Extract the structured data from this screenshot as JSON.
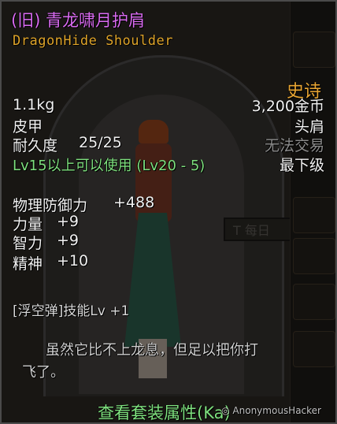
{
  "item": {
    "name": "(旧) 青龙啸月护肩",
    "name_en": "DragonHide Shoulder",
    "rarity": "史诗",
    "weight": "1.1kg",
    "price": "3,200金币",
    "material": "皮甲",
    "slot": "头肩",
    "durability_label": "耐久度",
    "durability_value": "25/25",
    "trade": "无法交易",
    "level_req": "Lv15以上可以使用 (Lv20 - 5)",
    "grade": "最下级",
    "stats": [
      {
        "label": "物理防御力",
        "value": "+488"
      },
      {
        "label": "力量",
        "value": "+9"
      },
      {
        "label": "智力",
        "value": "+9"
      },
      {
        "label": "精神",
        "value": "+10"
      }
    ],
    "skill": "[浮空弹]技能Lv +1",
    "flavor_line1": "虽然它比不上龙息，但足以把你打",
    "flavor_line2": "飞了。",
    "set_button": "查看套装属性(Ka)"
  },
  "scene": {
    "sign_text": "每日"
  },
  "watermark": "AnonymousHacker",
  "colors": {
    "title": "#d96bf0",
    "subtitle": "#e0a52a",
    "rarity": "#e8a533",
    "green": "#7ee07e",
    "gray": "#8c8c8c"
  }
}
